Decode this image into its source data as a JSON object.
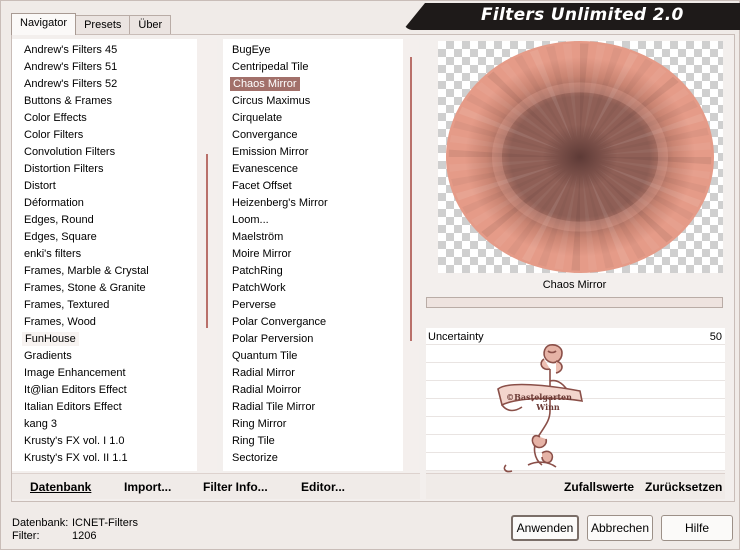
{
  "app": {
    "title": "Filters Unlimited 2.0"
  },
  "tabs": [
    {
      "label": "Navigator",
      "active": true
    },
    {
      "label": "Presets",
      "active": false
    },
    {
      "label": "Über",
      "active": false
    }
  ],
  "categories": {
    "items": [
      "Andrew's Filters 45",
      "Andrew's Filters 51",
      "Andrew's Filters 52",
      "Buttons & Frames",
      "Color Effects",
      "Color Filters",
      "Convolution Filters",
      "Distortion Filters",
      "Distort",
      "Déformation",
      "Edges, Round",
      "Edges, Square",
      "enki's filters",
      "Frames, Marble & Crystal",
      "Frames, Stone & Granite",
      "Frames, Textured",
      "Frames, Wood",
      "FunHouse",
      "Gradients",
      "Image Enhancement",
      "It@lian Editors Effect",
      "Italian Editors Effect",
      "kang 3",
      "Krusty's FX vol. I 1.0",
      "Krusty's FX vol. II 1.1"
    ],
    "highlighted": "FunHouse"
  },
  "filters": {
    "items": [
      "BugEye",
      "Centripedal Tile",
      "Chaos Mirror",
      "Circus Maximus",
      "Cirquelate",
      "Convergance",
      "Emission Mirror",
      "Evanescence",
      "Facet Offset",
      "Heizenberg's Mirror",
      "Loom...",
      "Maelström",
      "Moire Mirror",
      "PatchRing",
      "PatchWork",
      "Perverse",
      "Polar Convergance",
      "Polar Perversion",
      "Quantum Tile",
      "Radial Mirror",
      "Radial Moirror",
      "Radial Tile Mirror",
      "Ring Mirror",
      "Ring Tile",
      "Sectorize"
    ],
    "selected": "Chaos Mirror"
  },
  "preview": {
    "filter_name": "Chaos Mirror",
    "colors": {
      "outer": "#e59b88",
      "mid": "#c98472",
      "inner": "#8f5f56",
      "center": "#5d3a36"
    },
    "stamp": {
      "line1": "©Bastelgarten",
      "line2": "Winn"
    }
  },
  "parameters": [
    {
      "label": "Uncertainty",
      "value": "50"
    }
  ],
  "toolbar_left": {
    "database": "Datenbank",
    "import": "Import...",
    "filter_info": "Filter Info...",
    "editor": "Editor..."
  },
  "toolbar_right": {
    "random": "Zufallswerte",
    "reset": "Zurücksetzen"
  },
  "status": {
    "database_label": "Datenbank:",
    "database_value": "ICNET-Filters",
    "filter_label": "Filter:",
    "filter_value": "1206"
  },
  "dialog_buttons": {
    "apply": "Anwenden",
    "cancel": "Abbrechen",
    "help": "Hilfe"
  }
}
